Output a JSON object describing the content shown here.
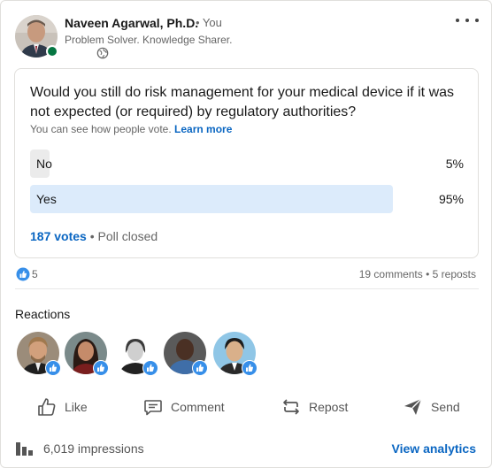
{
  "post": {
    "author_name": "Naveen Agarwal, Ph.D.",
    "author_degree": "• You",
    "author_headline": "Problem Solver. Knowledge Sharer.",
    "visibility_icon": "globe-icon",
    "more_icon": "more-horizontal-icon"
  },
  "poll": {
    "question": "Would you still do risk management for your medical device if it was not expected (or required) by regulatory authorities?",
    "visibility_note": "You can see how people vote.",
    "learn_more": "Learn more",
    "options": [
      {
        "label": "No",
        "percent_label": "5%",
        "share": 0.05
      },
      {
        "label": "Yes",
        "percent_label": "95%",
        "share": 0.95
      }
    ],
    "votes": "187 votes",
    "status": "• Poll closed"
  },
  "social": {
    "reaction_count": "5",
    "comments": "19 comments",
    "separator": " • ",
    "reposts": "5 reposts"
  },
  "reactions": {
    "title": "Reactions"
  },
  "actions": {
    "like": "Like",
    "comment": "Comment",
    "repost": "Repost",
    "send": "Send"
  },
  "analytics": {
    "impressions": "6,019 impressions",
    "view_label": "View analytics"
  },
  "colors": {
    "accent": "#0a66c2",
    "bar_selected": "#dcebfb",
    "bar_other": "#ebebeb",
    "presence": "#057642"
  }
}
